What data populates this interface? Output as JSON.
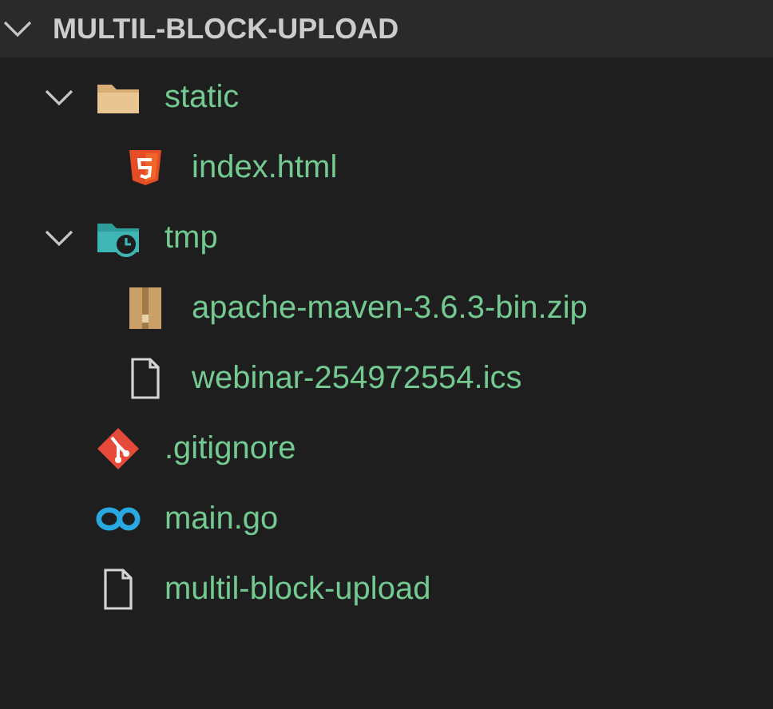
{
  "explorer": {
    "title": "MULTIL-BLOCK-UPLOAD",
    "expanded": true,
    "items": [
      {
        "name": "static",
        "kind": "folder",
        "expanded": true,
        "children": [
          {
            "name": "index.html",
            "kind": "html"
          }
        ]
      },
      {
        "name": "tmp",
        "kind": "temp-folder",
        "expanded": true,
        "children": [
          {
            "name": "apache-maven-3.6.3-bin.zip",
            "kind": "archive"
          },
          {
            "name": "webinar-254972554.ics",
            "kind": "file"
          }
        ]
      },
      {
        "name": ".gitignore",
        "kind": "git"
      },
      {
        "name": "main.go",
        "kind": "go"
      },
      {
        "name": "multil-block-upload",
        "kind": "file"
      }
    ]
  }
}
